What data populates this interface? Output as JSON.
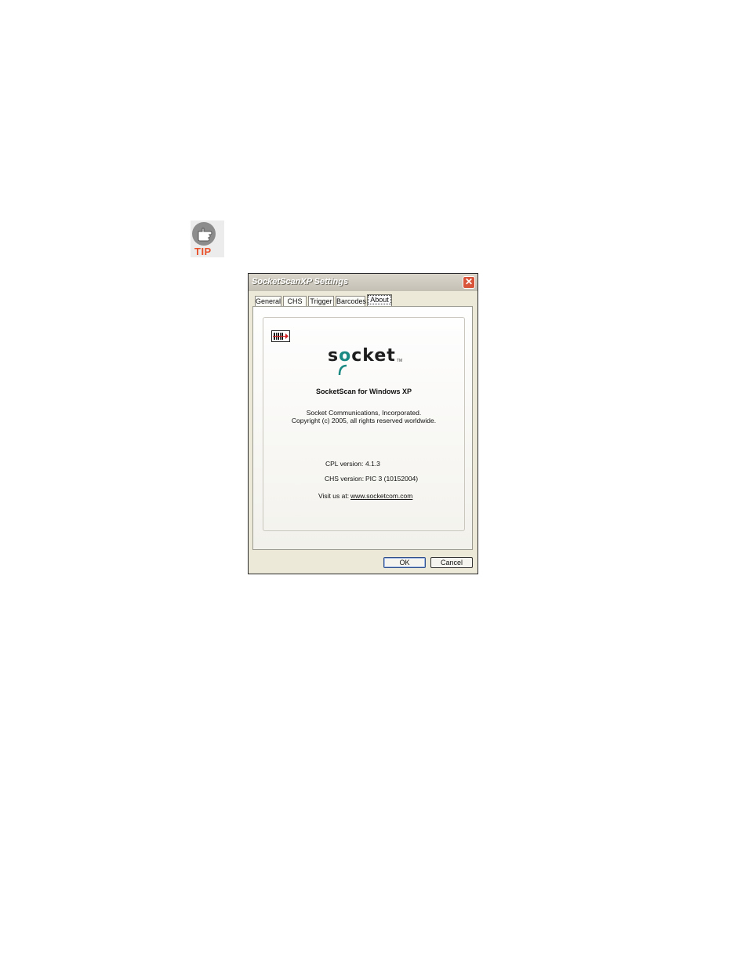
{
  "tip": {
    "label": "TIP",
    "icon": "pointing-hand-icon"
  },
  "window": {
    "title": "SocketScanXP Settings",
    "close_glyph": "✕",
    "tabs": [
      {
        "label": "General"
      },
      {
        "label": "CHS"
      },
      {
        "label": "Trigger"
      },
      {
        "label": "Barcodes"
      },
      {
        "label": "About"
      }
    ],
    "active_tab": "About",
    "about": {
      "logo_text_before": "s",
      "logo_text_o": "o",
      "logo_text_after": "cket",
      "logo_tm": "TM",
      "product_name": "SocketScan for Windows XP",
      "company_line1": "Socket Communications, Incorporated.",
      "company_line2": "Copyright (c) 2005, all rights reserved worldwide.",
      "cpl_label": "CPL version:",
      "cpl_value": "4.1.3",
      "chs_label": "CHS version:",
      "chs_value": "PIC 3 (10152004)",
      "visit_label": "Visit us at:",
      "visit_link": "www.socketcom.com"
    },
    "buttons": {
      "ok": "OK",
      "cancel": "Cancel"
    }
  },
  "colors": {
    "tip_orange": "#e8502a",
    "logo_teal": "#1a8a83",
    "close_red": "#d8543a"
  }
}
